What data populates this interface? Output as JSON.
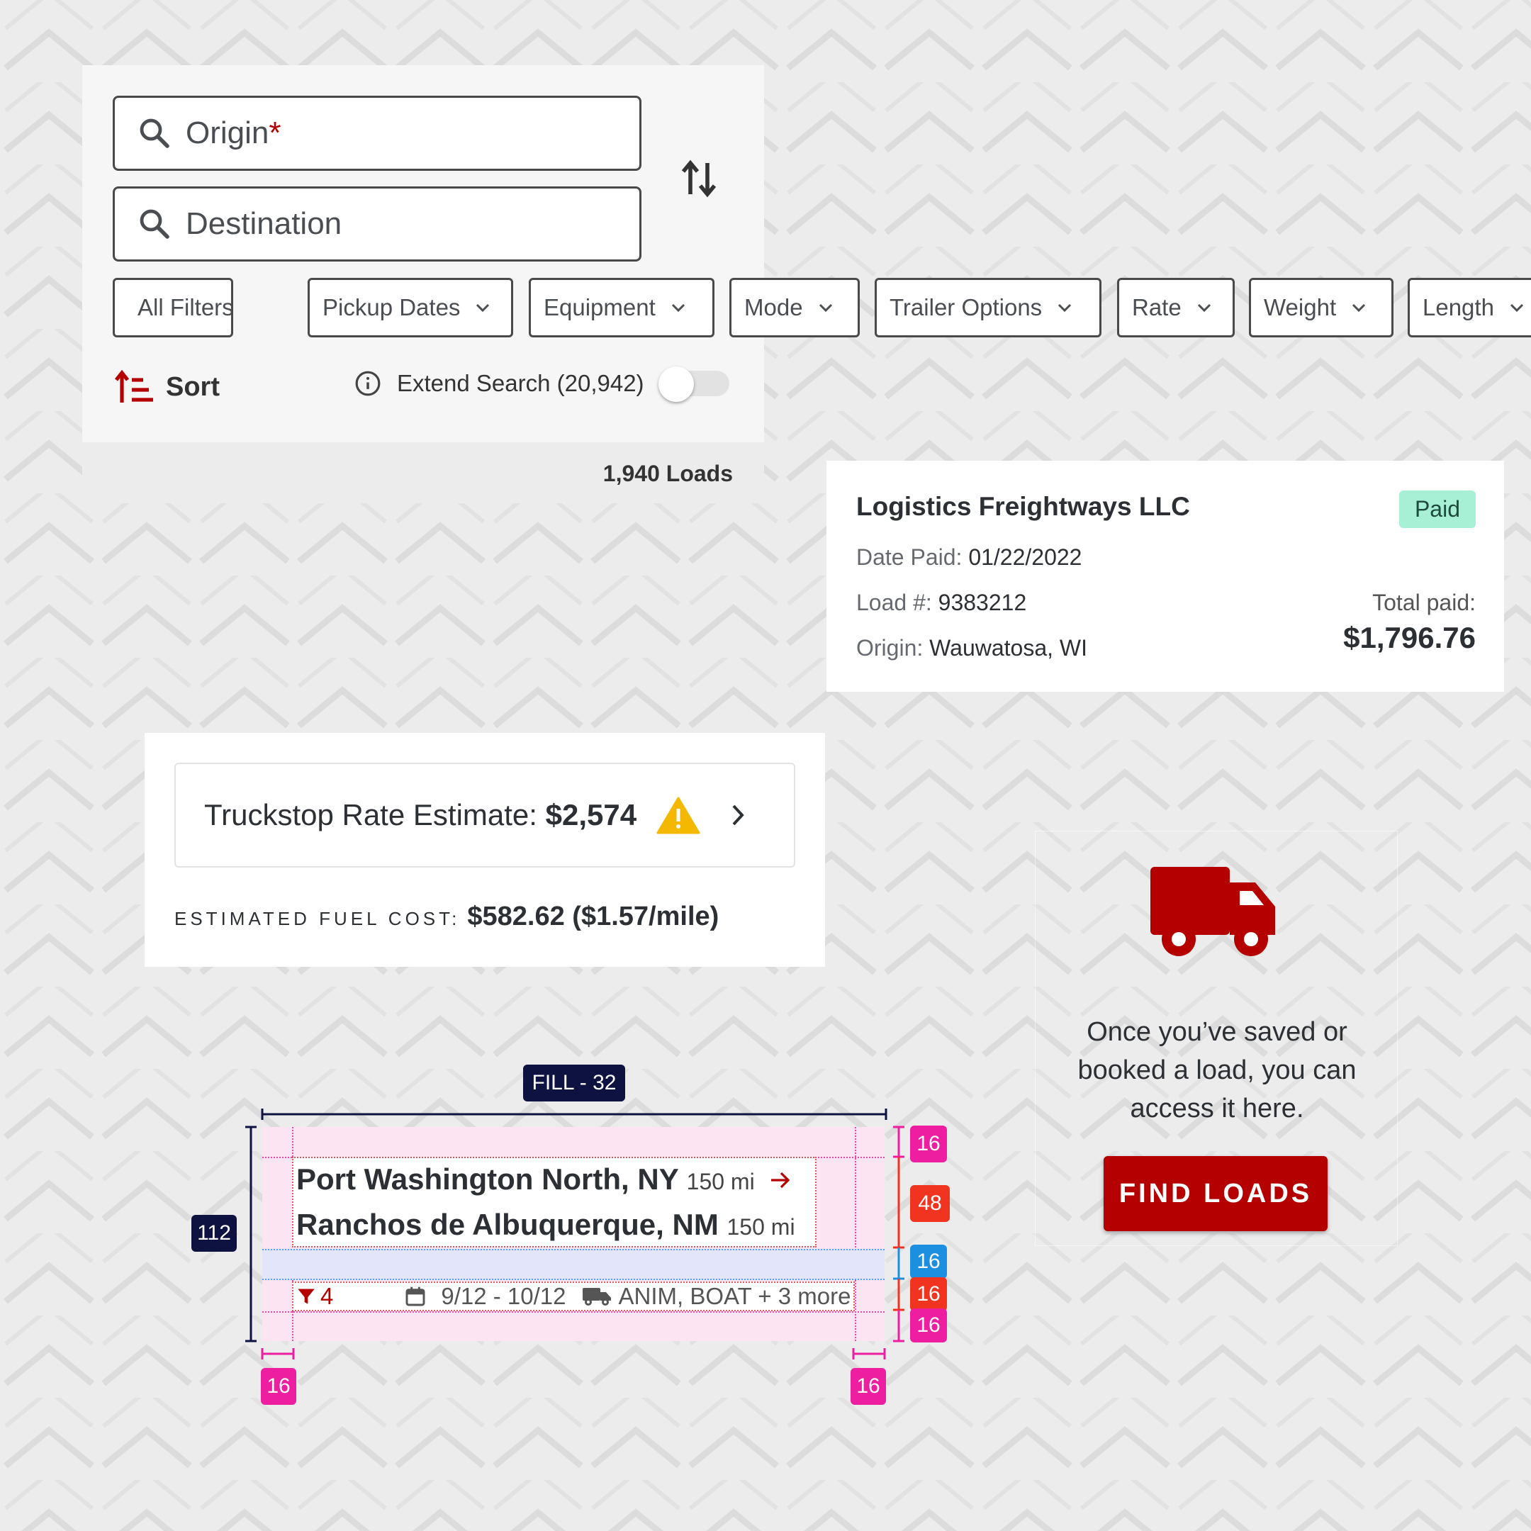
{
  "search": {
    "origin_placeholder": "Origin",
    "origin_required_mark": "*",
    "destination_placeholder": "Destination",
    "filters": [
      {
        "label": "All Filters",
        "icon": "funnel-icon"
      },
      {
        "label": "Pickup Dates"
      },
      {
        "label": "Equipment"
      },
      {
        "label": "Mode"
      },
      {
        "label": "Trailer Options"
      },
      {
        "label": "Rate"
      },
      {
        "label": "Weight"
      },
      {
        "label": "Length"
      }
    ],
    "sort_label": "Sort",
    "extend_search_label": "Extend Search (20,942)",
    "extend_search_on": false,
    "loads_count": "1,940 Loads"
  },
  "payment_card": {
    "company": "Logistics Freightways LLC",
    "status": "Paid",
    "date_paid_label": "Date Paid:",
    "date_paid_value": "01/22/2022",
    "load_label": "Load #:",
    "load_value": "9383212",
    "origin_label": "Origin:",
    "origin_value": "Wauwatosa, WI",
    "total_label": "Total paid:",
    "total_value": "$1,796.76"
  },
  "rate_card": {
    "estimate_label": "Truckstop Rate Estimate:",
    "estimate_value": "$2,574",
    "fuel_label": "ESTIMATED FUEL COST:",
    "fuel_value": "$582.62 ($1.57/mile)"
  },
  "empty_state": {
    "message_line1": "Once you’ve saved or",
    "message_line2": "booked a load, you can",
    "message_line3": "access it here.",
    "button_label": "FIND LOADS"
  },
  "load_spec": {
    "width_tag": "FILL - 32",
    "height_tag": "112",
    "origin_city": "Port Washington North, NY",
    "origin_distance": "150 mi",
    "destination_city": "Ranchos de Albuquerque, NM",
    "destination_distance": "150 mi",
    "filter_count": "4",
    "date_range": "9/12 - 10/12",
    "equipment": "ANIM, BOAT + 3 more",
    "spacing": {
      "top_padding": "16",
      "route_block": "48",
      "gap": "16",
      "detail_row": "16",
      "bottom_padding": "16",
      "left_padding": "16",
      "right_padding": "16"
    }
  },
  "colors": {
    "brand_red": "#b50000",
    "paid_badge": "#a7f0d5",
    "warning": "#f5b800",
    "spec_pink": "#ee1ea0",
    "spec_red": "#f0341f",
    "spec_blue": "#1c8fe0",
    "spec_navy": "#0d1240"
  }
}
